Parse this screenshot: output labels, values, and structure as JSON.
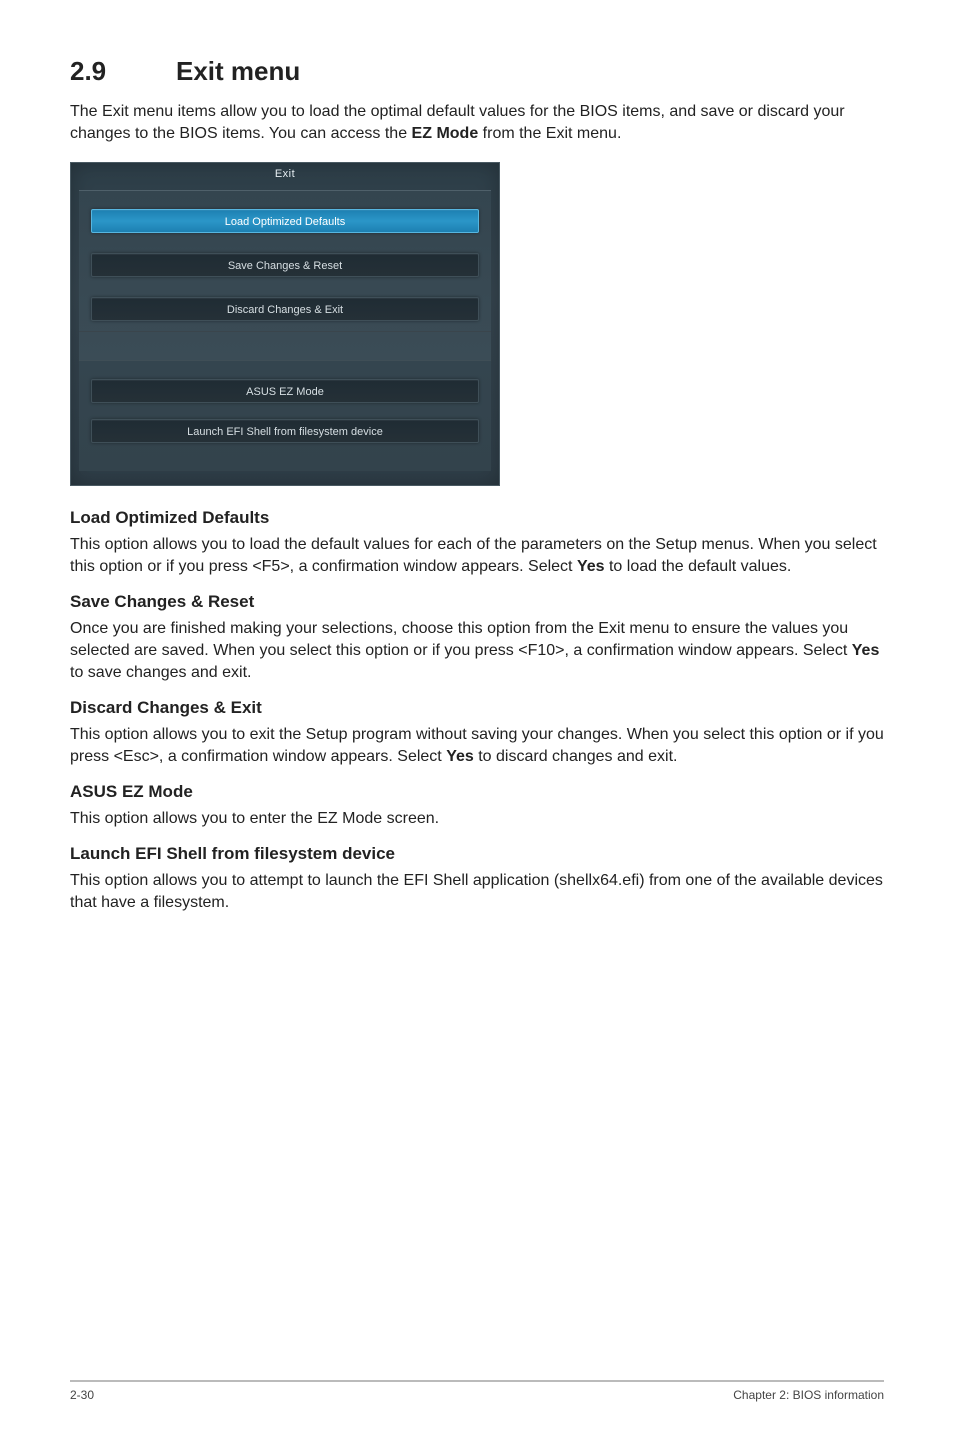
{
  "heading": {
    "number": "2.9",
    "title": "Exit menu"
  },
  "intro_parts": {
    "p1": "The Exit menu items allow you to load the optimal default values for the BIOS items, and save or discard your changes to the BIOS items. You can access the ",
    "bold": "EZ Mode",
    "p2": " from the Exit menu."
  },
  "bios": {
    "tab": "Exit",
    "items_top": [
      {
        "label": "Load Optimized Defaults",
        "selected": true
      },
      {
        "label": "Save Changes & Reset",
        "selected": false
      },
      {
        "label": "Discard Changes & Exit",
        "selected": false
      }
    ],
    "items_bottom": [
      {
        "label": "ASUS EZ Mode",
        "selected": false
      },
      {
        "label": "Launch EFI Shell from filesystem device",
        "selected": false
      }
    ]
  },
  "sections": {
    "s0": {
      "head": "Load Optimized Defaults",
      "p1": "This option allows you to load the default values for each of the parameters on the Setup menus. When you select this option or if you press <F5>, a confirmation window appears. Select ",
      "b": "Yes",
      "p2": " to load the default values."
    },
    "s1": {
      "head": "Save Changes & Reset",
      "p1": "Once you are finished making your selections, choose this option from the Exit menu to ensure the values you selected are saved. When you select this option or if you press <F10>, a confirmation window appears. Select ",
      "b": "Yes",
      "p2": " to save changes and exit."
    },
    "s2": {
      "head": "Discard Changes & Exit",
      "p1": "This option allows you to exit the Setup program without saving your changes. When you select this option or if you press <Esc>, a confirmation window appears. Select ",
      "b": "Yes",
      "p2": " to discard changes and exit."
    },
    "s3": {
      "head": "ASUS EZ Mode",
      "p1": "This option allows you to enter the EZ Mode screen."
    },
    "s4": {
      "head": "Launch EFI Shell from filesystem device",
      "p1": "This option allows you to attempt to launch the EFI Shell application (shellx64.efi) from one of the available devices that have a filesystem."
    }
  },
  "footer": {
    "left": "2-30",
    "right": "Chapter 2: BIOS information"
  }
}
